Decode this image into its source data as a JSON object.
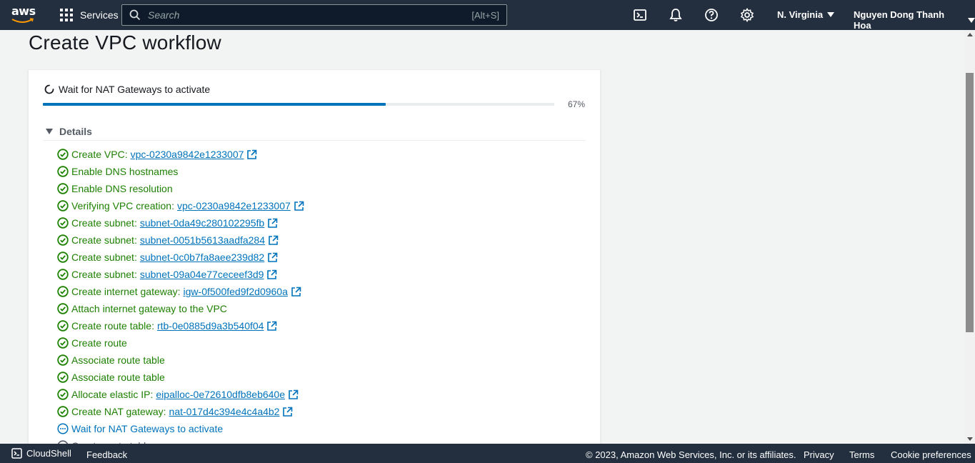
{
  "topnav": {
    "logo_text": "aws",
    "services_label": "Services",
    "search_placeholder": "Search",
    "search_shortcut": "[Alt+S]",
    "region_label": "N. Virginia",
    "user_label": "Nguyen Dong Thanh Hoa",
    "icons": [
      "cloudshell-icon",
      "bell-icon",
      "help-icon",
      "gear-icon"
    ]
  },
  "page": {
    "title": "Create VPC workflow"
  },
  "workflow": {
    "status_text": "Wait for NAT Gateways to activate",
    "progress_percent": 67,
    "progress_label": "67%",
    "details_label": "Details",
    "steps": [
      {
        "text": "Create VPC:",
        "link": "vpc-0230a9842e1233007",
        "status": "success"
      },
      {
        "text": "Enable DNS hostnames",
        "link": null,
        "status": "success"
      },
      {
        "text": "Enable DNS resolution",
        "link": null,
        "status": "success"
      },
      {
        "text": "Verifying VPC creation:",
        "link": "vpc-0230a9842e1233007",
        "status": "success"
      },
      {
        "text": "Create subnet:",
        "link": "subnet-0da49c280102295fb",
        "status": "success"
      },
      {
        "text": "Create subnet:",
        "link": "subnet-0051b5613aadfa284",
        "status": "success"
      },
      {
        "text": "Create subnet:",
        "link": "subnet-0c0b7fa8aee239d82",
        "status": "success"
      },
      {
        "text": "Create subnet:",
        "link": "subnet-09a04e77ceceef3d9",
        "status": "success"
      },
      {
        "text": "Create internet gateway:",
        "link": "igw-0f500fed9f2d0960a",
        "status": "success"
      },
      {
        "text": "Attach internet gateway to the VPC",
        "link": null,
        "status": "success"
      },
      {
        "text": "Create route table:",
        "link": "rtb-0e0885d9a3b540f04",
        "status": "success"
      },
      {
        "text": "Create route",
        "link": null,
        "status": "success"
      },
      {
        "text": "Associate route table",
        "link": null,
        "status": "success"
      },
      {
        "text": "Associate route table",
        "link": null,
        "status": "success"
      },
      {
        "text": "Allocate elastic IP:",
        "link": "eipalloc-0e72610dfb8eb640e",
        "status": "success"
      },
      {
        "text": "Create NAT gateway:",
        "link": "nat-017d4c394e4c4a4b2",
        "status": "success"
      },
      {
        "text": "Wait for NAT Gateways to activate",
        "link": null,
        "status": "pending"
      },
      {
        "text": "Create route table",
        "link": null,
        "status": "todo"
      }
    ]
  },
  "footer": {
    "cloudshell_label": "CloudShell",
    "feedback_label": "Feedback",
    "copyright": "© 2023, Amazon Web Services, Inc. or its affiliates.",
    "privacy_label": "Privacy",
    "terms_label": "Terms",
    "cookie_label": "Cookie preferences"
  },
  "colors": {
    "nav_bg": "#232f3e",
    "success": "#1d8102",
    "link": "#0073bb",
    "progress": "#0073bb"
  }
}
